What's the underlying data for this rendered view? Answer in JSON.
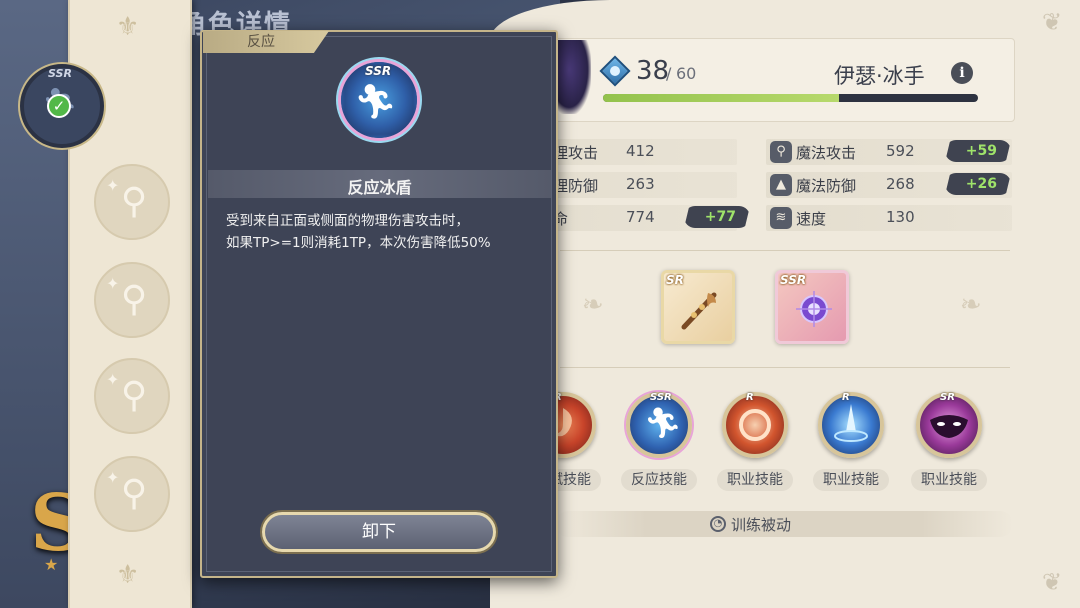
{
  "background": {
    "title": "角色详情",
    "rank_letter": "S"
  },
  "hero": {
    "level": "38",
    "level_sep": "/",
    "level_max": "60",
    "xp_fraction": 0.63,
    "name": "伊瑟·冰手",
    "info_icon": "i"
  },
  "stats": {
    "left": [
      {
        "label": "物理攻击",
        "value": "412",
        "bonus": ""
      },
      {
        "label": "物理防御",
        "value": "263",
        "bonus": ""
      },
      {
        "label": "生命",
        "value": "774",
        "bonus": "+77"
      }
    ],
    "right": [
      {
        "label": "魔法攻击",
        "value": "592",
        "bonus": "+59"
      },
      {
        "label": "魔法防御",
        "value": "268",
        "bonus": "+26"
      },
      {
        "label": "速度",
        "value": "130",
        "bonus": ""
      }
    ]
  },
  "equipment": [
    {
      "rarity": "SR",
      "icon": "staff-icon"
    },
    {
      "rarity": "SSR",
      "icon": "orb-icon"
    }
  ],
  "skills": [
    {
      "label": "天赋技能",
      "rarity": "R",
      "icon": "flame-swirl-icon"
    },
    {
      "label": "反应技能",
      "rarity": "SSR",
      "icon": "run-icon"
    },
    {
      "label": "职业技能",
      "rarity": "R",
      "icon": "fire-ring-icon"
    },
    {
      "label": "职业技能",
      "rarity": "R",
      "icon": "ice-spike-icon"
    },
    {
      "label": "职业技能",
      "rarity": "SR",
      "icon": "mask-icon"
    }
  ],
  "train": {
    "label": "训练被动"
  },
  "slots": {
    "active_rarity": "SSR",
    "empty_count": 4
  },
  "popup": {
    "tab": "反应",
    "rarity": "SSR",
    "title": "反应冰盾",
    "description_line1": "受到来自正面或侧面的物理伤害攻击时，",
    "description_line2": "如果TP>=1则消耗1TP，本次伤害降低50%",
    "unequip_label": "卸下"
  },
  "colors": {
    "bonus_text": "#9fe36a",
    "xp_fill": "#93c24c",
    "popup_bg": "#3e4456",
    "parchment": "#efe9dc",
    "check": "#52b848"
  }
}
